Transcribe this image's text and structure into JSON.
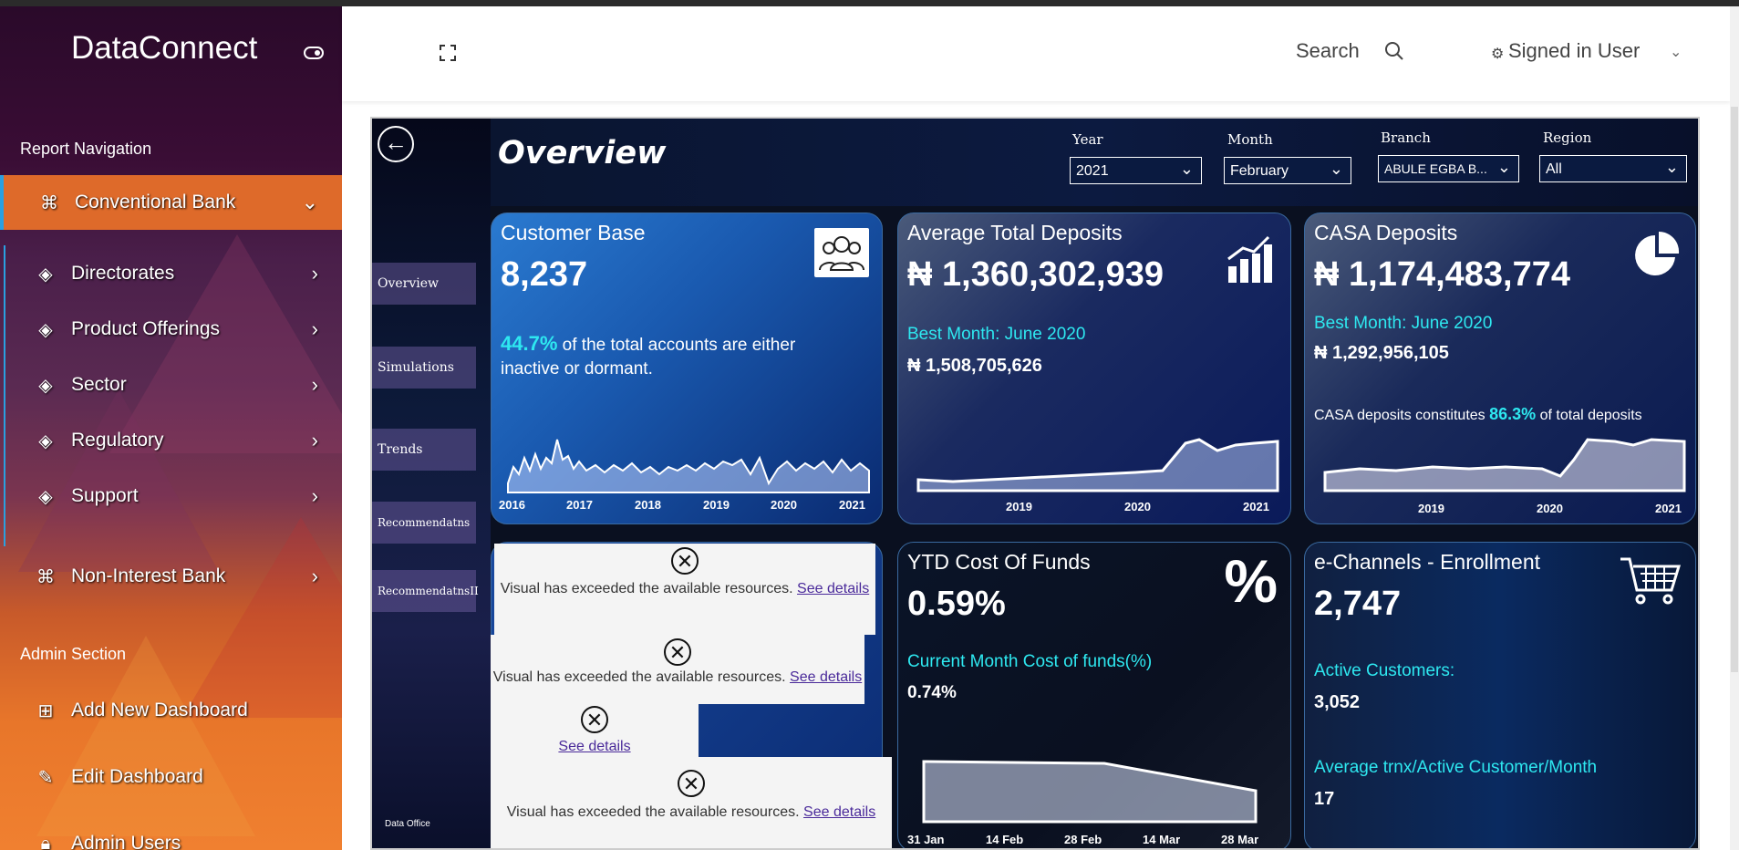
{
  "app": {
    "brand": "DataConnect"
  },
  "header": {
    "search_label": "Search",
    "user_label": "Signed in User"
  },
  "sidebar": {
    "report_nav_title": "Report Navigation",
    "admin_title": "Admin Section",
    "items": [
      {
        "label": "Conventional Bank",
        "icon": "command-icon"
      },
      {
        "label": "Directorates",
        "icon": "layers-icon"
      },
      {
        "label": "Product Offerings",
        "icon": "layers-icon"
      },
      {
        "label": "Sector",
        "icon": "layers-icon"
      },
      {
        "label": "Regulatory",
        "icon": "layers-icon"
      },
      {
        "label": "Support",
        "icon": "layers-icon"
      },
      {
        "label": "Non-Interest Bank",
        "icon": "command-icon"
      }
    ],
    "admin_items": [
      {
        "label": "Add New Dashboard",
        "icon": "file-plus-icon"
      },
      {
        "label": "Edit Dashboard",
        "icon": "edit-icon"
      },
      {
        "label": "Admin Users",
        "icon": "lock-icon"
      }
    ]
  },
  "report": {
    "title": "Overview",
    "tabs": [
      "Overview",
      "Simulations",
      "Trends",
      "Recommendatns",
      "RecommendatnsII"
    ],
    "logo_text": "Data Office",
    "filters": {
      "year": {
        "label": "Year",
        "value": "2021"
      },
      "month": {
        "label": "Month",
        "value": "February"
      },
      "branch": {
        "label": "Branch",
        "value": "ABULE EGBA B..."
      },
      "region": {
        "label": "Region",
        "value": "All"
      }
    },
    "cards": {
      "customer_base": {
        "title": "Customer Base",
        "value": "8,237",
        "pct": "44.7%",
        "text": "of the total accounts are either inactive or dormant.",
        "ticks": [
          "2016",
          "2017",
          "2018",
          "2019",
          "2020",
          "2021"
        ]
      },
      "avg_deposits": {
        "title": "Average Total Deposits",
        "value": "₦ 1,360,302,939",
        "best_label": "Best Month: June 2020",
        "best_value": "₦ 1,508,705,626",
        "ticks": [
          "2019",
          "2020",
          "2021"
        ]
      },
      "casa": {
        "title": "CASA Deposits",
        "value": "₦ 1,174,483,774",
        "best_label": "Best Month: June 2020",
        "best_value": "₦ 1,292,956,105",
        "info_pre": "CASA deposits constitutes",
        "info_pct": "86.3%",
        "info_post": "of total deposits",
        "ticks": [
          "2019",
          "2020",
          "2021"
        ]
      },
      "cof": {
        "title": "YTD Cost Of Funds",
        "value": "0.59%",
        "current_label": "Current Month Cost of funds(%)",
        "current_value": "0.74%",
        "ticks": [
          "31 Jan",
          "14 Feb",
          "28 Feb",
          "14 Mar",
          "28 Mar"
        ]
      },
      "echannels": {
        "title": "e-Channels - Enrollment",
        "value": "2,747",
        "active_label": "Active Customers:",
        "active_value": "3,052",
        "avg_label": "Average trnx/Active Customer/Month",
        "avg_value": "17"
      }
    },
    "errors": {
      "message": "Visual has exceeded the available resources.",
      "link": "See details",
      "link_split_1": "See",
      "link_split_2": "details"
    }
  },
  "colors": {
    "accent_orange": "#de6a2a",
    "accent_blue": "#2aa0e0",
    "cyan": "#2ee8f0"
  }
}
